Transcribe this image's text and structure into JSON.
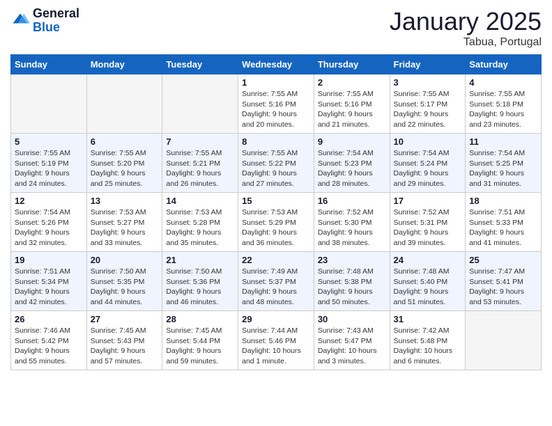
{
  "header": {
    "logo_general": "General",
    "logo_blue": "Blue",
    "month": "January 2025",
    "location": "Tabua, Portugal"
  },
  "weekdays": [
    "Sunday",
    "Monday",
    "Tuesday",
    "Wednesday",
    "Thursday",
    "Friday",
    "Saturday"
  ],
  "weeks": [
    [
      {
        "day": "",
        "empty": true
      },
      {
        "day": "",
        "empty": true
      },
      {
        "day": "",
        "empty": true
      },
      {
        "day": "1",
        "sunrise": "7:55 AM",
        "sunset": "5:16 PM",
        "daylight": "9 hours and 20 minutes."
      },
      {
        "day": "2",
        "sunrise": "7:55 AM",
        "sunset": "5:16 PM",
        "daylight": "9 hours and 21 minutes."
      },
      {
        "day": "3",
        "sunrise": "7:55 AM",
        "sunset": "5:17 PM",
        "daylight": "9 hours and 22 minutes."
      },
      {
        "day": "4",
        "sunrise": "7:55 AM",
        "sunset": "5:18 PM",
        "daylight": "9 hours and 23 minutes."
      }
    ],
    [
      {
        "day": "5",
        "sunrise": "7:55 AM",
        "sunset": "5:19 PM",
        "daylight": "9 hours and 24 minutes."
      },
      {
        "day": "6",
        "sunrise": "7:55 AM",
        "sunset": "5:20 PM",
        "daylight": "9 hours and 25 minutes."
      },
      {
        "day": "7",
        "sunrise": "7:55 AM",
        "sunset": "5:21 PM",
        "daylight": "9 hours and 26 minutes."
      },
      {
        "day": "8",
        "sunrise": "7:55 AM",
        "sunset": "5:22 PM",
        "daylight": "9 hours and 27 minutes."
      },
      {
        "day": "9",
        "sunrise": "7:54 AM",
        "sunset": "5:23 PM",
        "daylight": "9 hours and 28 minutes."
      },
      {
        "day": "10",
        "sunrise": "7:54 AM",
        "sunset": "5:24 PM",
        "daylight": "9 hours and 29 minutes."
      },
      {
        "day": "11",
        "sunrise": "7:54 AM",
        "sunset": "5:25 PM",
        "daylight": "9 hours and 31 minutes."
      }
    ],
    [
      {
        "day": "12",
        "sunrise": "7:54 AM",
        "sunset": "5:26 PM",
        "daylight": "9 hours and 32 minutes."
      },
      {
        "day": "13",
        "sunrise": "7:53 AM",
        "sunset": "5:27 PM",
        "daylight": "9 hours and 33 minutes."
      },
      {
        "day": "14",
        "sunrise": "7:53 AM",
        "sunset": "5:28 PM",
        "daylight": "9 hours and 35 minutes."
      },
      {
        "day": "15",
        "sunrise": "7:53 AM",
        "sunset": "5:29 PM",
        "daylight": "9 hours and 36 minutes."
      },
      {
        "day": "16",
        "sunrise": "7:52 AM",
        "sunset": "5:30 PM",
        "daylight": "9 hours and 38 minutes."
      },
      {
        "day": "17",
        "sunrise": "7:52 AM",
        "sunset": "5:31 PM",
        "daylight": "9 hours and 39 minutes."
      },
      {
        "day": "18",
        "sunrise": "7:51 AM",
        "sunset": "5:33 PM",
        "daylight": "9 hours and 41 minutes."
      }
    ],
    [
      {
        "day": "19",
        "sunrise": "7:51 AM",
        "sunset": "5:34 PM",
        "daylight": "9 hours and 42 minutes."
      },
      {
        "day": "20",
        "sunrise": "7:50 AM",
        "sunset": "5:35 PM",
        "daylight": "9 hours and 44 minutes."
      },
      {
        "day": "21",
        "sunrise": "7:50 AM",
        "sunset": "5:36 PM",
        "daylight": "9 hours and 46 minutes."
      },
      {
        "day": "22",
        "sunrise": "7:49 AM",
        "sunset": "5:37 PM",
        "daylight": "9 hours and 48 minutes."
      },
      {
        "day": "23",
        "sunrise": "7:48 AM",
        "sunset": "5:38 PM",
        "daylight": "9 hours and 50 minutes."
      },
      {
        "day": "24",
        "sunrise": "7:48 AM",
        "sunset": "5:40 PM",
        "daylight": "9 hours and 51 minutes."
      },
      {
        "day": "25",
        "sunrise": "7:47 AM",
        "sunset": "5:41 PM",
        "daylight": "9 hours and 53 minutes."
      }
    ],
    [
      {
        "day": "26",
        "sunrise": "7:46 AM",
        "sunset": "5:42 PM",
        "daylight": "9 hours and 55 minutes."
      },
      {
        "day": "27",
        "sunrise": "7:45 AM",
        "sunset": "5:43 PM",
        "daylight": "9 hours and 57 minutes."
      },
      {
        "day": "28",
        "sunrise": "7:45 AM",
        "sunset": "5:44 PM",
        "daylight": "9 hours and 59 minutes."
      },
      {
        "day": "29",
        "sunrise": "7:44 AM",
        "sunset": "5:46 PM",
        "daylight": "10 hours and 1 minute."
      },
      {
        "day": "30",
        "sunrise": "7:43 AM",
        "sunset": "5:47 PM",
        "daylight": "10 hours and 3 minutes."
      },
      {
        "day": "31",
        "sunrise": "7:42 AM",
        "sunset": "5:48 PM",
        "daylight": "10 hours and 6 minutes."
      },
      {
        "day": "",
        "empty": true
      }
    ]
  ]
}
